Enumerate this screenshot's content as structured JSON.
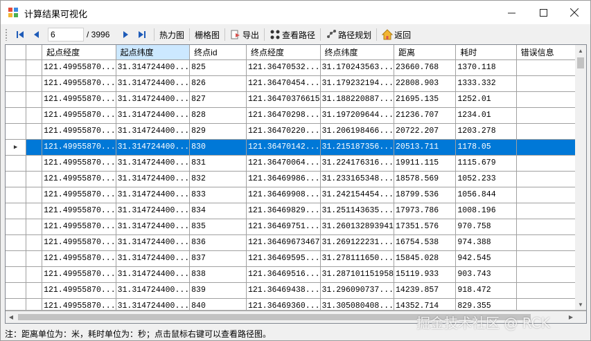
{
  "window": {
    "title": "计算结果可视化"
  },
  "toolbar": {
    "page_value": "6",
    "page_total": "/ 3996",
    "heatmap_label": "热力图",
    "grid_label": "栅格图",
    "export_label": "导出",
    "view_path_label": "查看路径",
    "route_plan_label": "路径规划",
    "back_label": "返回"
  },
  "table": {
    "columns": [
      "起点经度",
      "起点纬度",
      "终点id",
      "终点经度",
      "终点纬度",
      "距离",
      "耗时",
      "错误信息"
    ],
    "selected_row": 5,
    "rows": [
      [
        "121.49955870...",
        "31.314724400...",
        "825",
        "121.36470532...",
        "31.170243563...",
        "23660.768",
        "1370.118",
        ""
      ],
      [
        "121.49955870...",
        "31.314724400...",
        "826",
        "121.36470454...",
        "31.179232194...",
        "22808.903",
        "1333.332",
        ""
      ],
      [
        "121.49955870...",
        "31.314724400...",
        "827",
        "121.36470376615",
        "31.188220887...",
        "21695.135",
        "1252.01",
        ""
      ],
      [
        "121.49955870...",
        "31.314724400...",
        "828",
        "121.36470298...",
        "31.197209644...",
        "21236.707",
        "1234.01",
        ""
      ],
      [
        "121.49955870...",
        "31.314724400...",
        "829",
        "121.36470220...",
        "31.206198466...",
        "20722.207",
        "1203.278",
        ""
      ],
      [
        "121.49955870...",
        "31.314724400...",
        "830",
        "121.36470142...",
        "31.215187356...",
        "20513.711",
        "1178.05",
        ""
      ],
      [
        "121.49955870...",
        "31.314724400...",
        "831",
        "121.36470064...",
        "31.224176316...",
        "19911.115",
        "1115.679",
        ""
      ],
      [
        "121.49955870...",
        "31.314724400...",
        "832",
        "121.36469986...",
        "31.233165348...",
        "18578.569",
        "1052.233",
        ""
      ],
      [
        "121.49955870...",
        "31.314724400...",
        "833",
        "121.36469908...",
        "31.242154454...",
        "18799.536",
        "1056.844",
        ""
      ],
      [
        "121.49955870...",
        "31.314724400...",
        "834",
        "121.36469829...",
        "31.251143635...",
        "17973.786",
        "1008.196",
        ""
      ],
      [
        "121.49955870...",
        "31.314724400...",
        "835",
        "121.36469751...",
        "31.260132893941",
        "17351.576",
        "970.758",
        ""
      ],
      [
        "121.49955870...",
        "31.314724400...",
        "836",
        "121.36469673467",
        "31.269122231...",
        "16754.538",
        "974.388",
        ""
      ],
      [
        "121.49955870...",
        "31.314724400...",
        "837",
        "121.36469595...",
        "31.278111650...",
        "15845.028",
        "942.545",
        ""
      ],
      [
        "121.49955870...",
        "31.314724400...",
        "838",
        "121.36469516...",
        "31.287101151958",
        "15119.933",
        "903.743",
        ""
      ],
      [
        "121.49955870...",
        "31.314724400...",
        "839",
        "121.36469438...",
        "31.296090737...",
        "14239.857",
        "918.472",
        ""
      ],
      [
        "121.49955870...",
        "31.314724400...",
        "840",
        "121.36469360...",
        "31.305080408...",
        "14352.714",
        "829.355",
        ""
      ]
    ]
  },
  "status": {
    "text": "注：距离单位为：米，耗时单位为：秒；点击鼠标右键可以查看路径图。"
  },
  "watermark": {
    "text": "掘金技术社区 @ RCK"
  },
  "colors": {
    "selection": "#0078d7",
    "accent": "#1e5bb8"
  }
}
